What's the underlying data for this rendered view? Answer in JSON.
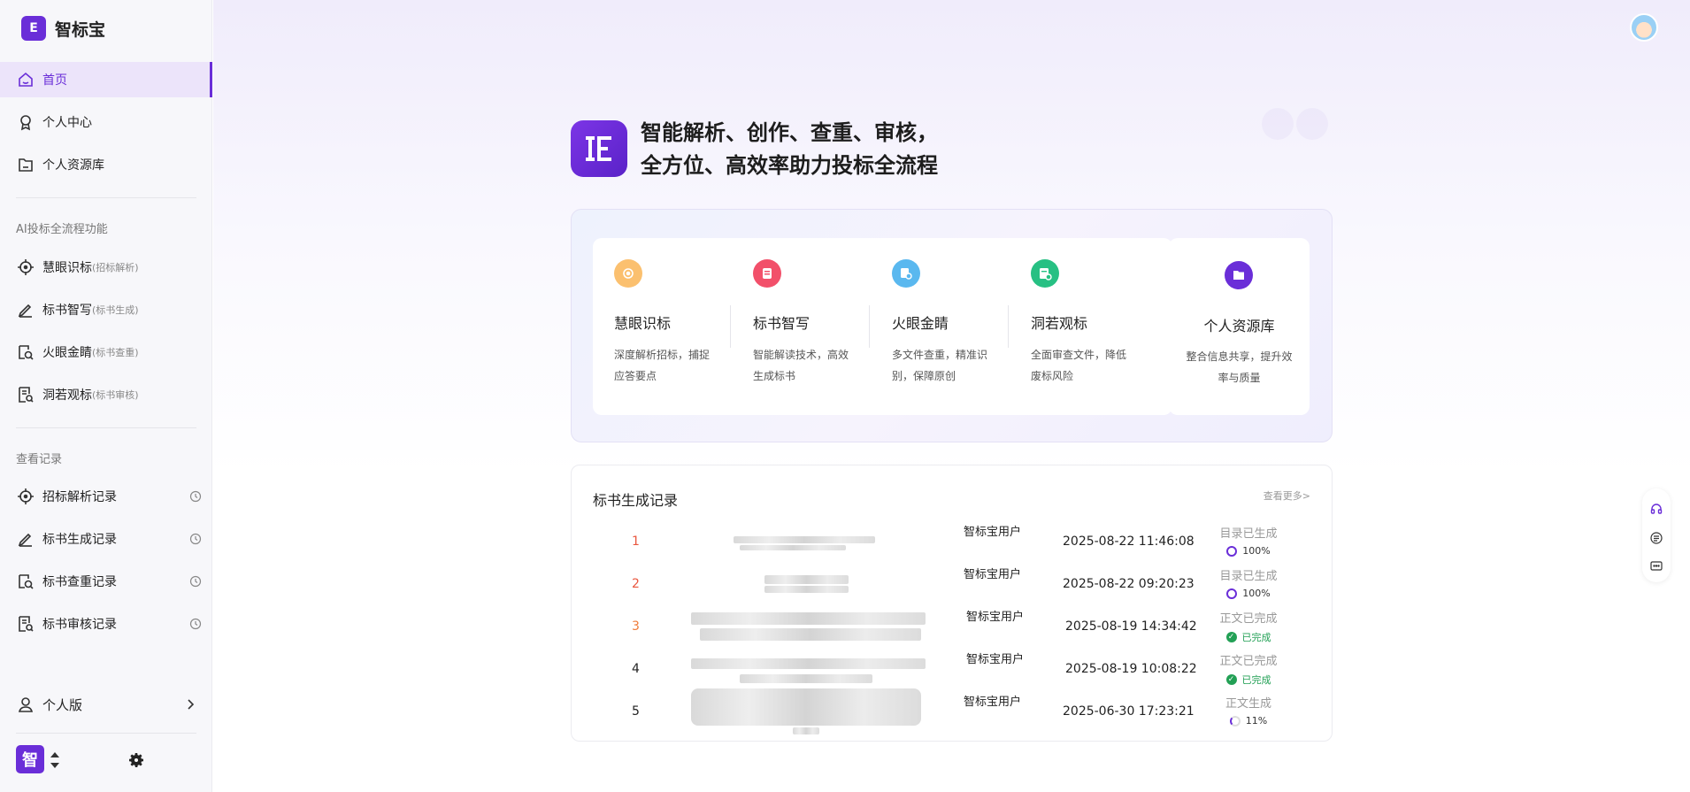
{
  "app": {
    "name": "智标宝",
    "logo_char": "E"
  },
  "sidebar": {
    "items": [
      {
        "label": "首页",
        "active": true
      },
      {
        "label": "个人中心"
      },
      {
        "label": "个人资源库"
      }
    ],
    "section1_title": "AI投标全流程功能",
    "functions": [
      {
        "label": "慧眼识标",
        "sub": "(招标解析)"
      },
      {
        "label": "标书智写",
        "sub": "(标书生成)"
      },
      {
        "label": "火眼金睛",
        "sub": "(标书查重)"
      },
      {
        "label": "洞若观标",
        "sub": "(标书审核)"
      }
    ],
    "section2_title": "查看记录",
    "records": [
      {
        "label": "招标解析记录"
      },
      {
        "label": "标书生成记录"
      },
      {
        "label": "标书查重记录"
      },
      {
        "label": "标书审核记录"
      }
    ],
    "version_label": "个人版",
    "brand_char": "智"
  },
  "hero": {
    "line1": "智能解析、创作、查重、审核，",
    "line2": "全方位、高效率助力投标全流程"
  },
  "features": [
    {
      "title": "慧眼识标",
      "desc": "深度解析招标，捕捉应答要点",
      "color": "#fbc06f"
    },
    {
      "title": "标书智写",
      "desc": "智能解读技术，高效生成标书",
      "color": "#f2506a"
    },
    {
      "title": "火眼金睛",
      "desc": "多文件查重，精准识别，保障原创",
      "color": "#5ab8ef"
    },
    {
      "title": "洞若观标",
      "desc": "全面审查文件，降低废标风险",
      "color": "#27c083"
    }
  ],
  "resource": {
    "title": "个人资源库",
    "desc": "整合信息共享，提升效率与质量"
  },
  "records": {
    "title": "标书生成记录",
    "more": "查看更多>",
    "rows": [
      {
        "index": "1",
        "user": "智标宝用户",
        "time": "2025-08-22 11:46:08",
        "status": "目录已生成",
        "progress": "100%",
        "state": "ring"
      },
      {
        "index": "2",
        "user": "智标宝用户",
        "time": "2025-08-22 09:20:23",
        "status": "目录已生成",
        "progress": "100%",
        "state": "ring"
      },
      {
        "index": "3",
        "user": "智标宝用户",
        "time": "2025-08-19 14:34:42",
        "status": "正文已完成",
        "progress": "已完成",
        "state": "done"
      },
      {
        "index": "4",
        "user": "智标宝用户",
        "time": "2025-08-19 10:08:22",
        "status": "正文已完成",
        "progress": "已完成",
        "state": "done"
      },
      {
        "index": "5",
        "user": "智标宝用户",
        "time": "2025-06-30 17:23:21",
        "status": "正文生成",
        "progress": "11%",
        "state": "partial"
      }
    ]
  },
  "colors": {
    "accent": "#6a2ed8",
    "index_red": "#e9573f",
    "index_orange": "#f07c3a",
    "done_green": "#22a055"
  }
}
